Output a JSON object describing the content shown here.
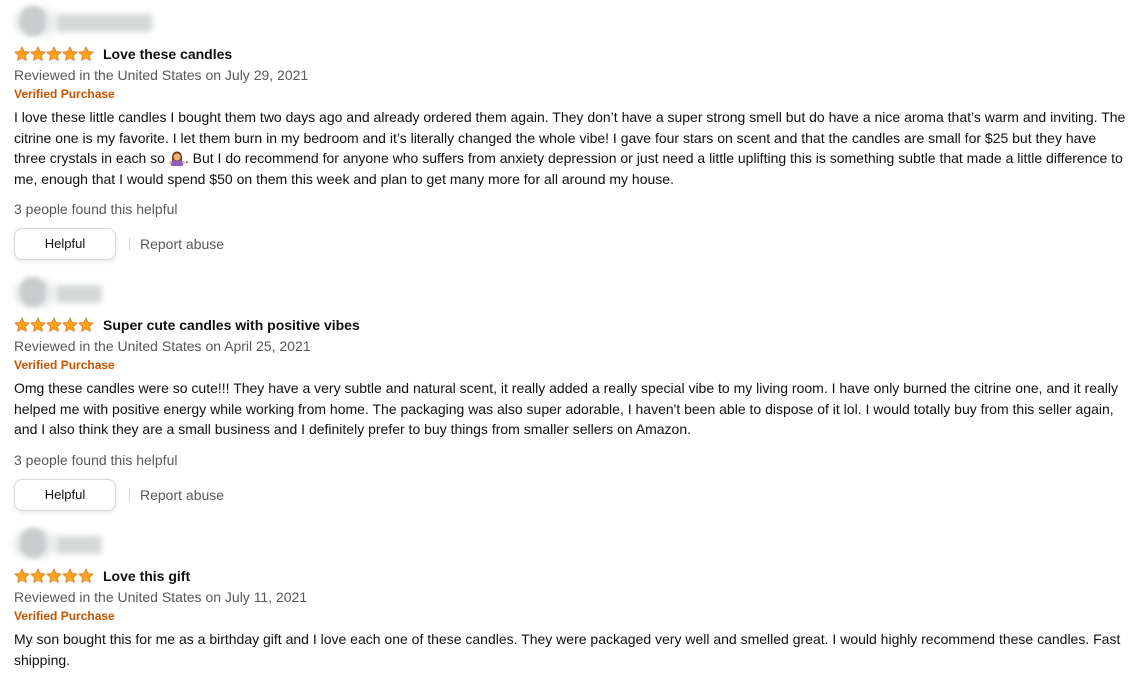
{
  "reviews": [
    {
      "rating": 5,
      "title": "Love these candles",
      "date": "Reviewed in the United States on July 29, 2021",
      "verified": "Verified Purchase",
      "body_before_emoji": "I love these little candles I bought them two days ago and already ordered them again. They don’t have a super strong smell but do have a nice aroma that’s warm and inviting. The citrine one is my favorite. I let them burn in my bedroom and it’s literally changed the whole vibe! I gave four stars on scent and that the candles are small for $25 but they have three crystals in each so ",
      "emoji": "woman-shrugging-emoji",
      "body_after_emoji": ". But I do recommend for anyone who suffers from anxiety depression or just need a little uplifting this is something subtle that made a little difference to me, enough that I would spend $50 on them this week and plan to get many more for all around my house.",
      "helpful_count": "3 people found this helpful",
      "helpful_label": "Helpful",
      "report_label": "Report abuse"
    },
    {
      "rating": 5,
      "title": "Super cute candles with positive vibes",
      "date": "Reviewed in the United States on April 25, 2021",
      "verified": "Verified Purchase",
      "body": "Omg these candles were so cute!!! They have a very subtle and natural scent, it really added a really special vibe to my living room. I have only burned the citrine one, and it really helped me with positive energy while working from home. The packaging was also super adorable, I haven't been able to dispose of it lol. I would totally buy from this seller again, and I also think they are a small business and I definitely prefer to buy things from smaller sellers on Amazon.",
      "helpful_count": "3 people found this helpful",
      "helpful_label": "Helpful",
      "report_label": "Report abuse"
    },
    {
      "rating": 5,
      "title": "Love this gift",
      "date": "Reviewed in the United States on July 11, 2021",
      "verified": "Verified Purchase",
      "body": "My son bought this for me as a birthday gift and I love each one of these candles. They were packaged very well and smelled great. I would highly recommend these candles. Fast shipping."
    }
  ],
  "colors": {
    "star_fill": "#ffa41c",
    "star_stroke": "#de7921",
    "verified": "#c45500",
    "secondary_text": "#565959",
    "primary_text": "#0f1111",
    "button_border": "#d5d9d9"
  },
  "icons": {
    "star": "star-icon",
    "avatar": "avatar-placeholder-blurred",
    "emoji": "woman-shrugging-emoji"
  }
}
